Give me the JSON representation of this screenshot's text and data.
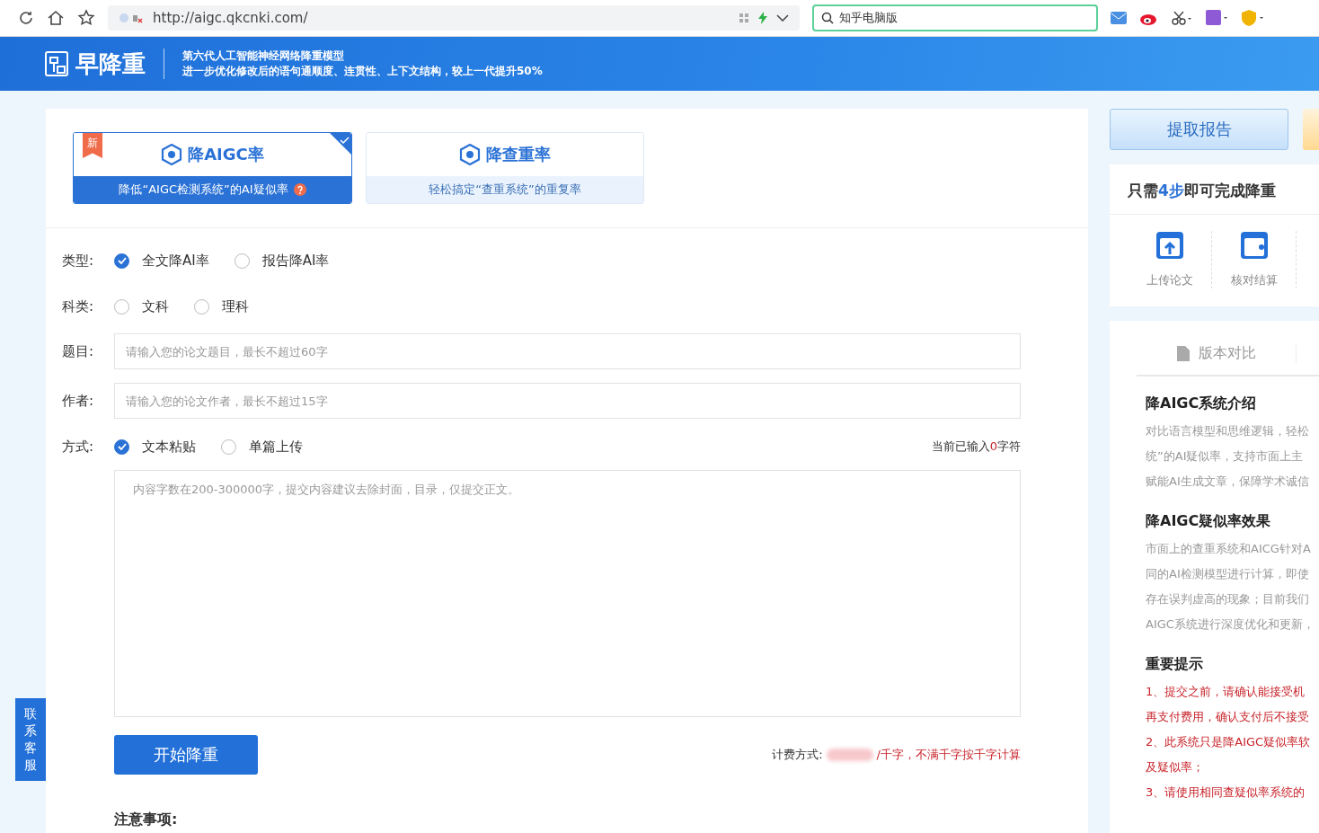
{
  "browser": {
    "url": "http://aigc.qkcnki.com/",
    "search_value": "知乎电脑版"
  },
  "banner": {
    "logo_text": "早降重",
    "headline": "第六代人工智能神经网络降重模型",
    "subline": "进一步优化修改后的语句通顺度、连贯性、上下文结构，较上一代提升50%"
  },
  "mode_cards": [
    {
      "title": "降AIGC率",
      "subtitle": "降低“AIGC检测系统”的AI疑似率",
      "badge": "新",
      "selected": true
    },
    {
      "title": "降查重率",
      "subtitle": "轻松搞定“查重系统”的重复率",
      "selected": false
    }
  ],
  "form": {
    "type": {
      "label": "类型:",
      "options": [
        {
          "label": "全文降AI率",
          "selected": true
        },
        {
          "label": "报告降AI率",
          "selected": false
        }
      ]
    },
    "subject": {
      "label": "科类:",
      "options": [
        {
          "label": "文科",
          "selected": false
        },
        {
          "label": "理科",
          "selected": false
        }
      ]
    },
    "title": {
      "label": "题目:",
      "placeholder": "请输入您的论文题目，最长不超过60字"
    },
    "author": {
      "label": "作者:",
      "placeholder": "请输入您的论文作者，最长不超过15字"
    },
    "method": {
      "label": "方式:",
      "options": [
        {
          "label": "文本粘贴",
          "selected": true
        },
        {
          "label": "单篇上传",
          "selected": false
        }
      ]
    },
    "counter": {
      "prefix": "当前已输入",
      "count": "0",
      "suffix": "字符"
    },
    "content": {
      "placeholder": "内容字数在200-300000字，提交内容建议去除封面，目录，仅提交正文。"
    },
    "submit": "开始降重",
    "pricing": {
      "label": "计费方式:",
      "value": "/千字，不满千字按千字计算"
    },
    "notes_title": "注意事项:"
  },
  "contact_tab": "联系客服",
  "side": {
    "report_button": "提取报告",
    "steps_title": {
      "before": "只需",
      "highlight": "4步",
      "after": "即可完成降重"
    },
    "steps": [
      "上传论文",
      "核对结算"
    ],
    "tabs": [
      {
        "label": "版本对比",
        "selected": false
      }
    ],
    "sections": [
      {
        "title": "降AIGC系统介绍",
        "kind": "info",
        "lines": [
          "对比语言模型和思维逻辑，轻松",
          "统”的AI疑似率，支持市面上主",
          "赋能AI生成文章，保障学术诚信"
        ]
      },
      {
        "title": "降AIGC疑似率效果",
        "kind": "info",
        "lines": [
          "市面上的查重系统和AICG针对A",
          "同的AI检测模型进行计算，即使",
          "存在误判虚高的现象；目前我们",
          "AIGC系统进行深度优化和更新，"
        ]
      },
      {
        "title": "重要提示",
        "kind": "warning",
        "lines": [
          "1、提交之前，请确认能接受机",
          "再支付费用，确认支付后不接受",
          "2、此系统只是降AIGC疑似率软",
          "及疑似率；",
          "3、请使用相同查疑似率系统的"
        ]
      }
    ]
  }
}
